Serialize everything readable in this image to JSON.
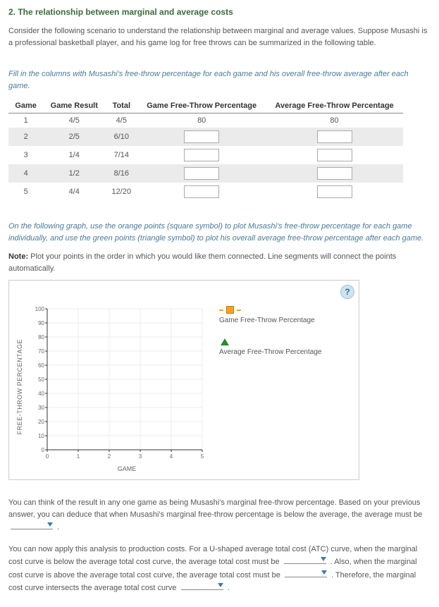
{
  "title": "2. The relationship between marginal and average costs",
  "intro1": "Consider the following scenario to understand the relationship between marginal and average values. Suppose Musashi is a professional basketball player, and his game log for free throws can be summarized in the following table.",
  "instr1": "Fill in the columns with Musashi's free-throw percentage for each game and his overall free-throw average after each game.",
  "table": {
    "headers": [
      "Game",
      "Game Result",
      "Total",
      "Game Free-Throw Percentage",
      "Average Free-Throw Percentage"
    ],
    "rows": [
      {
        "game": "1",
        "result": "4/5",
        "total": "4/5",
        "gftp": "80",
        "aftp": "80",
        "input": false
      },
      {
        "game": "2",
        "result": "2/5",
        "total": "6/10",
        "gftp": "",
        "aftp": "",
        "input": true
      },
      {
        "game": "3",
        "result": "1/4",
        "total": "7/14",
        "gftp": "",
        "aftp": "",
        "input": true
      },
      {
        "game": "4",
        "result": "1/2",
        "total": "8/16",
        "gftp": "",
        "aftp": "",
        "input": true
      },
      {
        "game": "5",
        "result": "4/4",
        "total": "12/20",
        "gftp": "",
        "aftp": "",
        "input": true
      }
    ]
  },
  "instr2": "On the following graph, use the orange points (square symbol) to plot Musashi's free-throw percentage for each game individually, and use the green points (triangle symbol) to plot his overall average free-throw percentage after each game.",
  "note_label": "Note:",
  "note_text": " Plot your points in the order in which you would like them connected. Line segments will connect the points automatically.",
  "chart": {
    "ylabel": "FREE-THROW PERCENTAGE",
    "xlabel": "GAME",
    "yticks": [
      "100",
      "90",
      "80",
      "70",
      "60",
      "50",
      "40",
      "30",
      "20",
      "10",
      "0"
    ],
    "xticks": [
      "0",
      "1",
      "2",
      "3",
      "4",
      "5"
    ],
    "legend1": "Game Free-Throw Percentage",
    "legend2": "Average Free-Throw Percentage",
    "help": "?"
  },
  "chart_data": {
    "type": "line",
    "title": "",
    "xlabel": "GAME",
    "ylabel": "FREE-THROW PERCENTAGE",
    "xlim": [
      0,
      5
    ],
    "ylim": [
      0,
      100
    ],
    "x_ticks": [
      0,
      1,
      2,
      3,
      4,
      5
    ],
    "y_ticks": [
      0,
      10,
      20,
      30,
      40,
      50,
      60,
      70,
      80,
      90,
      100
    ],
    "series": [
      {
        "name": "Game Free-Throw Percentage",
        "marker": "square",
        "color": "#f7a12a",
        "values": []
      },
      {
        "name": "Average Free-Throw Percentage",
        "marker": "triangle",
        "color": "#2a8a2a",
        "values": []
      }
    ]
  },
  "para2a": "You can think of the result in any one game as being Musashi's marginal free-throw percentage. Based on your previous answer, you can deduce that when Musashi's marginal free-throw percentage is below the average, the average must be",
  "para2b": ".",
  "para3a": "You can now apply this analysis to production costs. For a U-shaped average total cost (ATC) curve, when the marginal cost curve is below the average total cost curve, the average total cost must be",
  "para3b": ". Also, when the marginal cost curve is above the average total cost curve, the average total cost must be",
  "para3c": ". Therefore, the marginal cost curve intersects the average total cost curve",
  "para3d": "."
}
